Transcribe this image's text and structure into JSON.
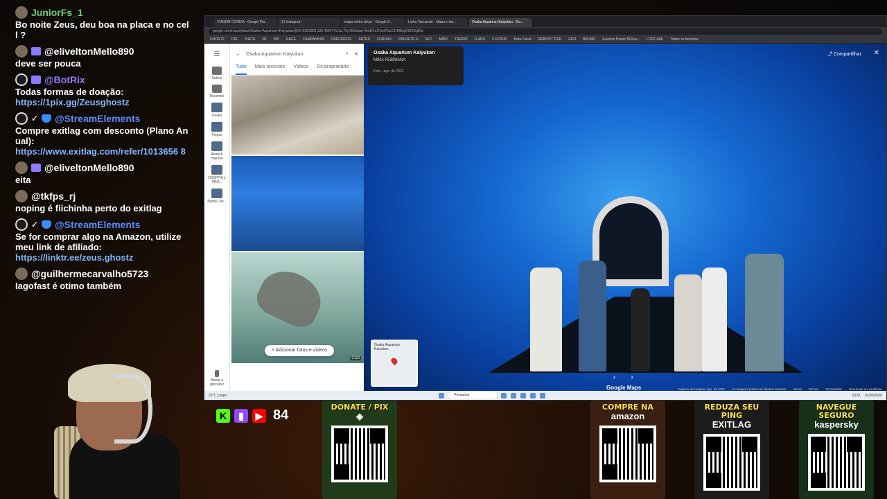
{
  "chat": {
    "messages": [
      {
        "user": "JuniorFs_1",
        "user_color": "#6cd26c",
        "text": "Bo noite Zeus, deu boa na placa e no cell ?",
        "badges": []
      },
      {
        "user": "@eliveltonMello890",
        "user_color": "#ffffff",
        "text": "deve ser pouca",
        "badges": [
          "#2"
        ]
      },
      {
        "user": "@BotRix",
        "user_color": "#8a7cff",
        "text": "Todas formas de doação:",
        "link": "https://1pix.gg/Zeusghostz",
        "badges": [
          "#3"
        ]
      },
      {
        "user": "@StreamElements",
        "user_color": "#5a8cff",
        "text": "Compre exitlag com desconto (Plano Anual):",
        "link": "https://www.exitlag.com/refer/1013656 8",
        "badges": []
      },
      {
        "user": "@eliveltonMello890",
        "user_color": "#ffffff",
        "text": "eita",
        "badges": [
          "#3"
        ]
      },
      {
        "user": "@tkfps_rj",
        "user_color": "#ffffff",
        "text": "noping é fiichinha perto do exitlag",
        "badges": []
      },
      {
        "user": "@StreamElements",
        "user_color": "#5a8cff",
        "text": "Se for comprar algo na Amazon, utilize meu link de afiliado:",
        "link": "https://linktr.ee/zeus.ghostz",
        "badges": []
      },
      {
        "user": "@guilhermecarvalho5723",
        "user_color": "#ffffff",
        "text": "Iagofast é otimo também",
        "badges": []
      }
    ]
  },
  "browser": {
    "tabs": [
      "VIAGEM COREIA - Google Pla...",
      "(2) Instagram",
      "mapa metro tokyo - Google S...",
      "Linha Yamanote - Mapa e tari...",
      "Osaka Aquarium Kaiyukan - Go..."
    ],
    "url": "google.com/maps/place/Osaka+Aquarium+Kaiyukan/@34.6559829,135.4294743,3a,75y,90t/data=!3m8!1e2!3m6!1sCIHM0ogKEICAgIDa",
    "bookmarks": [
      "GHOSTZ",
      "CDL",
      "DIETA",
      "NF",
      "WP",
      "RACE",
      "CAMPANHAS",
      "PARCEIROS",
      "ARTES",
      "FÓRUNS",
      "PROJETO G",
      "NFT",
      "MMO",
      "TREINO",
      "G ADS",
      "CLICKUP",
      "Nota Fiscal",
      "REBOOT TIER",
      "EDO",
      "BRUNO",
      "Eventos Power BI Rev...",
      "LOST ARK",
      "Todos os favoritos"
    ]
  },
  "maps": {
    "rail": [
      {
        "label": "Salvos",
        "icon": "bookmark-icon"
      },
      {
        "label": "Recentes",
        "icon": "history-icon"
      },
      {
        "label": "Osaka",
        "icon": "thumb"
      },
      {
        "label": "Tóquio",
        "icon": "thumb"
      },
      {
        "label": "Atami & Hakone",
        "icon": "thumb"
      },
      {
        "label": "HOSPITA L PRO...",
        "icon": "thumb"
      },
      {
        "label": "Narita City...",
        "icon": "thumb"
      }
    ],
    "download_app": "Baixar o aplicativo",
    "search_query": "Osaka Aquarium Kaiyukan",
    "tabs": [
      "Tudo",
      "Mais recentes",
      "Vídeos",
      "Do proprietário"
    ],
    "add_photos": "Adicionar fotos e vídeos",
    "video_duration": "0:20",
    "viewer": {
      "title": "Osaka Aquarium Kaiyukan",
      "author": "MIRA FEBRIANA",
      "date": "Foto - ago. de 2021",
      "share": "Compartilhar",
      "brand": "Google Maps",
      "minimap_label": "Osaka Aquarium Kaiyukan",
      "footer": [
        "Captura da imagem: ago. de 2021",
        "As imagens podem ter direitos autorais.",
        "Brasil",
        "Termos",
        "Privacidade",
        "Denunciar um problema"
      ]
    }
  },
  "taskbar": {
    "weather": "22°C Limpo",
    "search_placeholder": "Pesquisar",
    "time": "23:51",
    "date": "01/03/2026"
  },
  "overlay": {
    "viewer_count": "84",
    "cards": [
      {
        "title": "DONATE / PIX",
        "subtitle": "",
        "bg": "#1f3b1a"
      },
      {
        "title": "COMPRE NA",
        "subtitle": "amazon",
        "bg": "#3b1f10"
      },
      {
        "title": "REDUZA SEU PING",
        "subtitle": "EXITLAG",
        "bg": "#1c1c1c"
      },
      {
        "title": "NAVEGUE SEGURO",
        "subtitle": "kaspersky",
        "bg": "#16301a"
      }
    ]
  }
}
